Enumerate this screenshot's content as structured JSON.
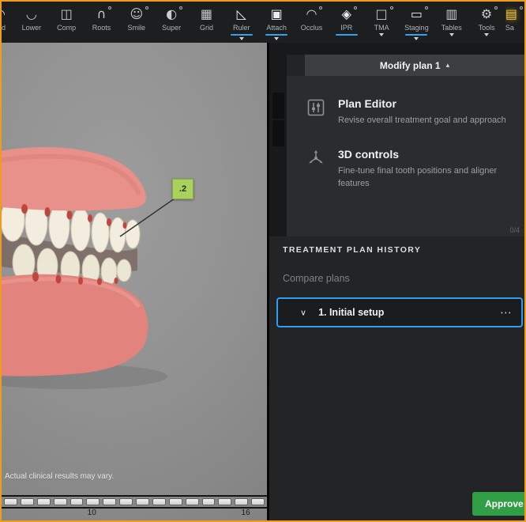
{
  "toolbar": {
    "accent_underline_color": "#33a1f2",
    "items": [
      {
        "name": "quad",
        "label": "d",
        "glyph": "◠",
        "active": false,
        "caret": false,
        "dot": false,
        "highlight": false
      },
      {
        "name": "lower",
        "label": "Lower",
        "glyph": "◡",
        "active": false,
        "caret": false,
        "dot": false,
        "highlight": false
      },
      {
        "name": "comp",
        "label": "Comp",
        "glyph": "◫",
        "active": false,
        "caret": false,
        "dot": false,
        "highlight": false
      },
      {
        "name": "roots",
        "label": "Roots",
        "glyph": "∩",
        "active": false,
        "caret": false,
        "dot": true,
        "highlight": false
      },
      {
        "name": "smile",
        "label": "Smile",
        "glyph": "☺",
        "active": false,
        "caret": false,
        "dot": true,
        "highlight": false
      },
      {
        "name": "super",
        "label": "Super",
        "glyph": "◐",
        "active": false,
        "caret": false,
        "dot": true,
        "highlight": false
      },
      {
        "name": "grid",
        "label": "Grid",
        "glyph": "▦",
        "active": false,
        "caret": false,
        "dot": false,
        "highlight": false
      },
      {
        "name": "ruler",
        "label": "Ruler",
        "glyph": "◺",
        "active": true,
        "caret": true,
        "dot": false,
        "highlight": false
      },
      {
        "name": "attach",
        "label": "Attach",
        "glyph": "▣",
        "active": true,
        "caret": true,
        "dot": false,
        "highlight": false
      },
      {
        "name": "occlus",
        "label": "Occlus",
        "glyph": "◠",
        "active": false,
        "caret": false,
        "dot": true,
        "highlight": false
      },
      {
        "name": "ipr",
        "label": "IPR",
        "glyph": "◈",
        "active": true,
        "caret": false,
        "dot": true,
        "highlight": false
      },
      {
        "name": "tma",
        "label": "TMA",
        "glyph": "□",
        "active": false,
        "caret": true,
        "dot": true,
        "highlight": false
      },
      {
        "name": "staging",
        "label": "Staging",
        "glyph": "▭",
        "active": true,
        "caret": true,
        "dot": true,
        "highlight": false
      },
      {
        "name": "tables",
        "label": "Tables",
        "glyph": "▥",
        "active": false,
        "caret": true,
        "dot": false,
        "highlight": false
      },
      {
        "name": "tools",
        "label": "Tools",
        "glyph": "⚙",
        "active": false,
        "caret": true,
        "dot": true,
        "highlight": false
      },
      {
        "name": "save",
        "label": "Sa",
        "glyph": "▤",
        "active": false,
        "caret": false,
        "dot": true,
        "highlight": true
      }
    ]
  },
  "viewport": {
    "ipr_label": ".2",
    "disclaimer": "Actual clinical results may vary.",
    "timeline": {
      "chip_count": 16,
      "labels": [
        {
          "text": "10",
          "pos": 34
        },
        {
          "text": "16",
          "pos": 92
        }
      ]
    }
  },
  "panel": {
    "header": {
      "label": "Modify plan 1"
    },
    "options": [
      {
        "title": "Plan Editor",
        "description": "Revise overall treatment goal and approach"
      },
      {
        "title": "3D controls",
        "description": "Fine-tune final tooth positions and aligner features"
      }
    ],
    "counter": "0/4",
    "history": {
      "heading": "TREATMENT PLAN HISTORY",
      "compare_label": "Compare plans",
      "plans": [
        {
          "title": "1. Initial setup"
        }
      ]
    },
    "approve_label": "Approve plan"
  },
  "colors": {
    "window_border": "#ef9b1d",
    "active_accent": "#33a1f2",
    "approve_green": "#2f9e44",
    "ipr_tag_green": "#aad15d",
    "plan_card_border": "#2e9df5"
  }
}
